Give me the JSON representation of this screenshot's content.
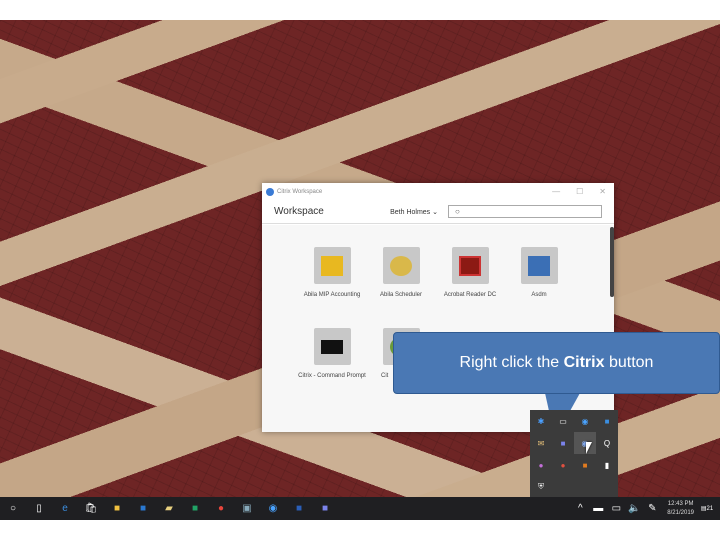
{
  "window": {
    "title": "Citrix Workspace",
    "heading": "Workspace",
    "user": "Beth Holmes",
    "search_placeholder": "",
    "controls": {
      "minimize": "—",
      "maximize": "☐",
      "close": "✕"
    }
  },
  "apps": [
    {
      "label": "Abila MIP Accounting",
      "color": "#e8b820"
    },
    {
      "label": "Abila Scheduler",
      "color": "#d9b84a"
    },
    {
      "label": "Acrobat Reader DC",
      "color": "#8c1a14"
    },
    {
      "label": "Asdm",
      "color": "#3b6fb5"
    },
    {
      "label": "Citrix - Command Prompt",
      "color": "#111111"
    },
    {
      "label": "Cit",
      "color": "#6a9a3a"
    }
  ],
  "callout": {
    "prefix": "Right click the ",
    "bold": "Citrix",
    "suffix": " button"
  },
  "tray_icons": [
    "bluetooth-icon",
    "usb-icon",
    "teamviewer-icon",
    "outlook-icon",
    "mail-icon",
    "teams-icon",
    "citrix-icon",
    "search-icon",
    "onenote-icon",
    "cloud-sync-icon",
    "java-icon",
    "usb-drive-icon",
    "security-icon"
  ],
  "taskbar": {
    "icons": [
      "cortana-icon",
      "task-view-icon",
      "edge-icon",
      "store-icon",
      "file-explorer-icon",
      "outlook-icon",
      "notes-icon",
      "excel-icon",
      "chrome-icon",
      "network-icon",
      "citrix-receiver-icon",
      "word-icon",
      "teams-icon"
    ],
    "time": "12:43 PM",
    "date": "8/21/2019",
    "notifications": "21"
  },
  "colors": {
    "callout": "#4a78b4",
    "taskbar": "#1f1f22"
  }
}
